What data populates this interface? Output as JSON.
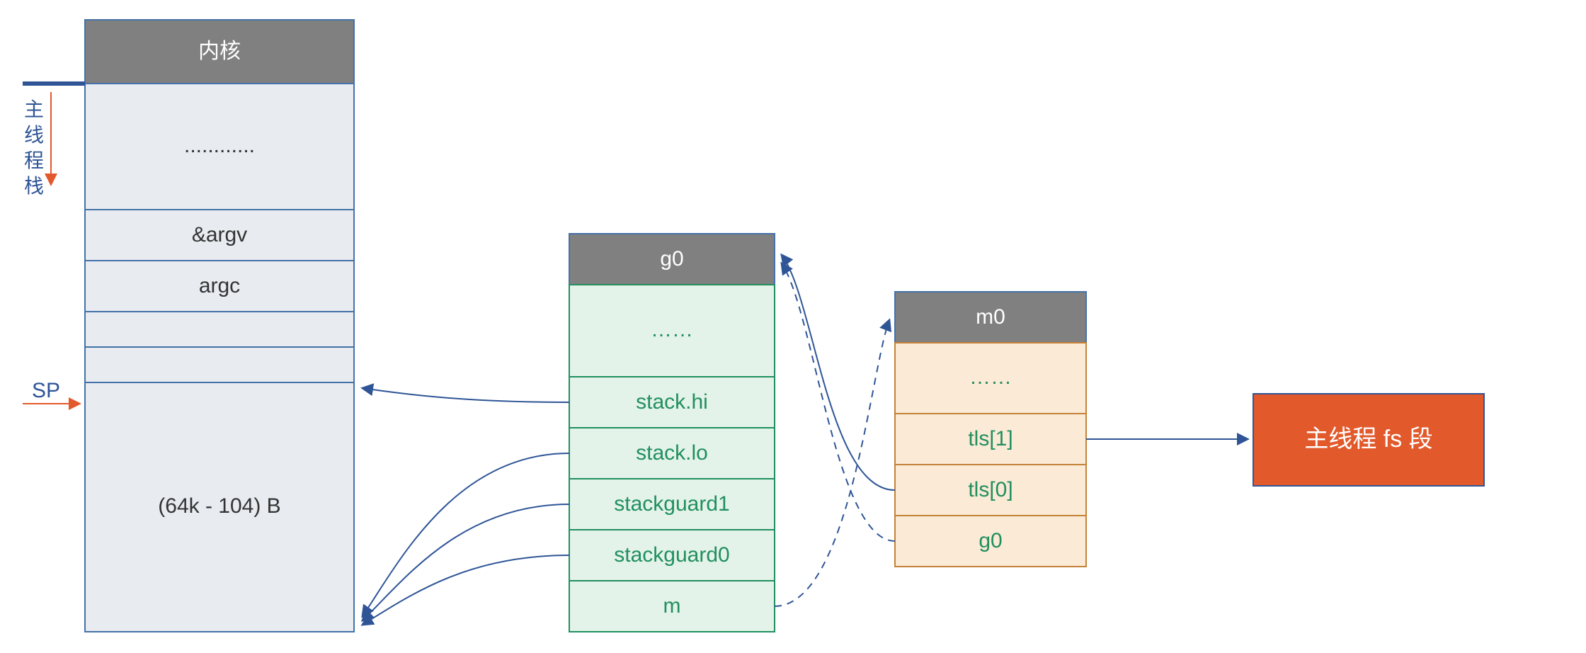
{
  "stack": {
    "header": "内核",
    "ellipsis": "............",
    "row_argv": "&argv",
    "row_argc": "argc",
    "body_label": "(64k - 104) B"
  },
  "side": {
    "c1": "主",
    "c2": "线",
    "c3": "程",
    "c4": "栈"
  },
  "sp_label": "SP",
  "g0": {
    "header": "g0",
    "ellipsis": "……",
    "stack_hi": "stack.hi",
    "stack_lo": "stack.lo",
    "guard1": "stackguard1",
    "guard0": "stackguard0",
    "m": "m"
  },
  "m0": {
    "header": "m0",
    "ellipsis": "……",
    "tls1": "tls[1]",
    "tls0": "tls[0]",
    "g0": "g0"
  },
  "fs_label": "主线程 fs 段"
}
